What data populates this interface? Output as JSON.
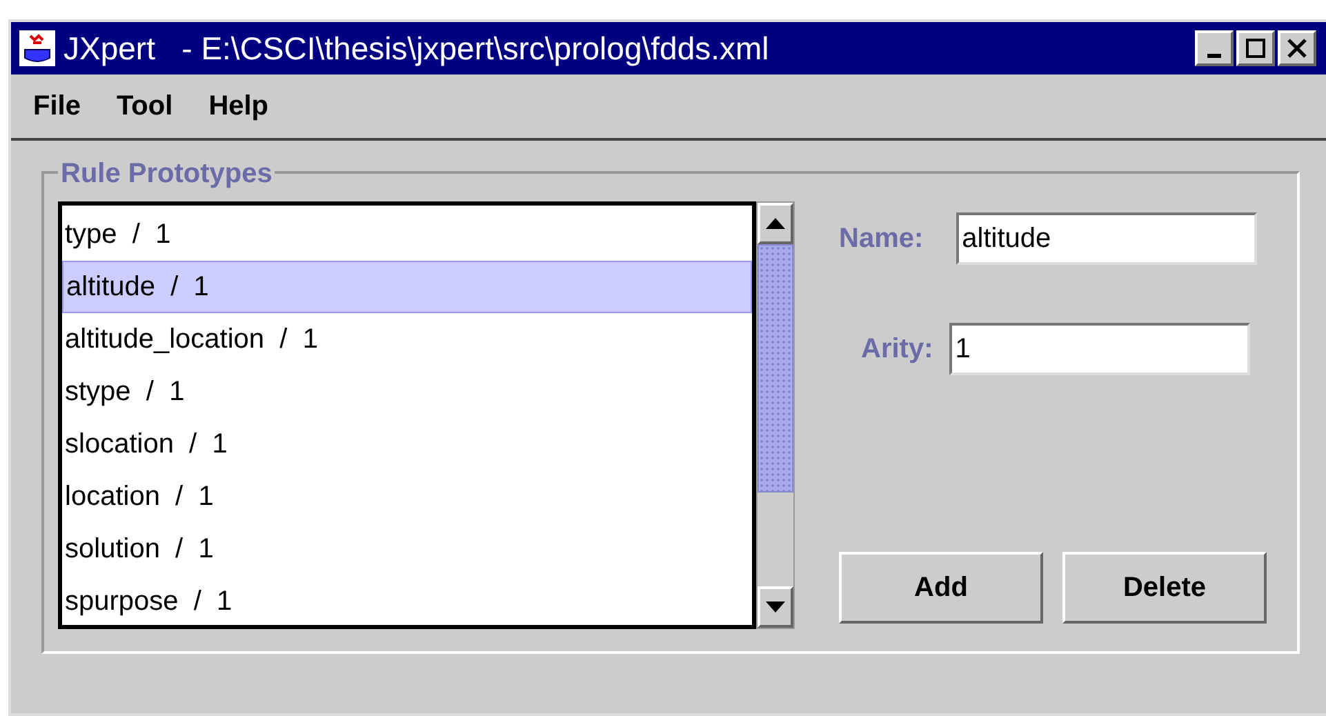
{
  "window": {
    "title": "JXpert   - E:\\CSCI\\thesis\\jxpert\\src\\prolog\\fdds.xml"
  },
  "menu": [
    "File",
    "Tool",
    "Help"
  ],
  "group": {
    "title": "Rule Prototypes"
  },
  "list": [
    {
      "label": "type  /  1",
      "selected": false
    },
    {
      "label": "altitude  /  1",
      "selected": true
    },
    {
      "label": "altitude_location  /  1",
      "selected": false
    },
    {
      "label": "stype  /  1",
      "selected": false
    },
    {
      "label": "slocation  /  1",
      "selected": false
    },
    {
      "label": "location  /  1",
      "selected": false
    },
    {
      "label": "solution  /  1",
      "selected": false
    },
    {
      "label": "spurpose  /  1",
      "selected": false
    }
  ],
  "fields": [
    {
      "label": "Name:",
      "value": "altitude"
    },
    {
      "label": "Arity:",
      "value": "1"
    }
  ],
  "buttons": [
    "Add",
    "Delete"
  ]
}
